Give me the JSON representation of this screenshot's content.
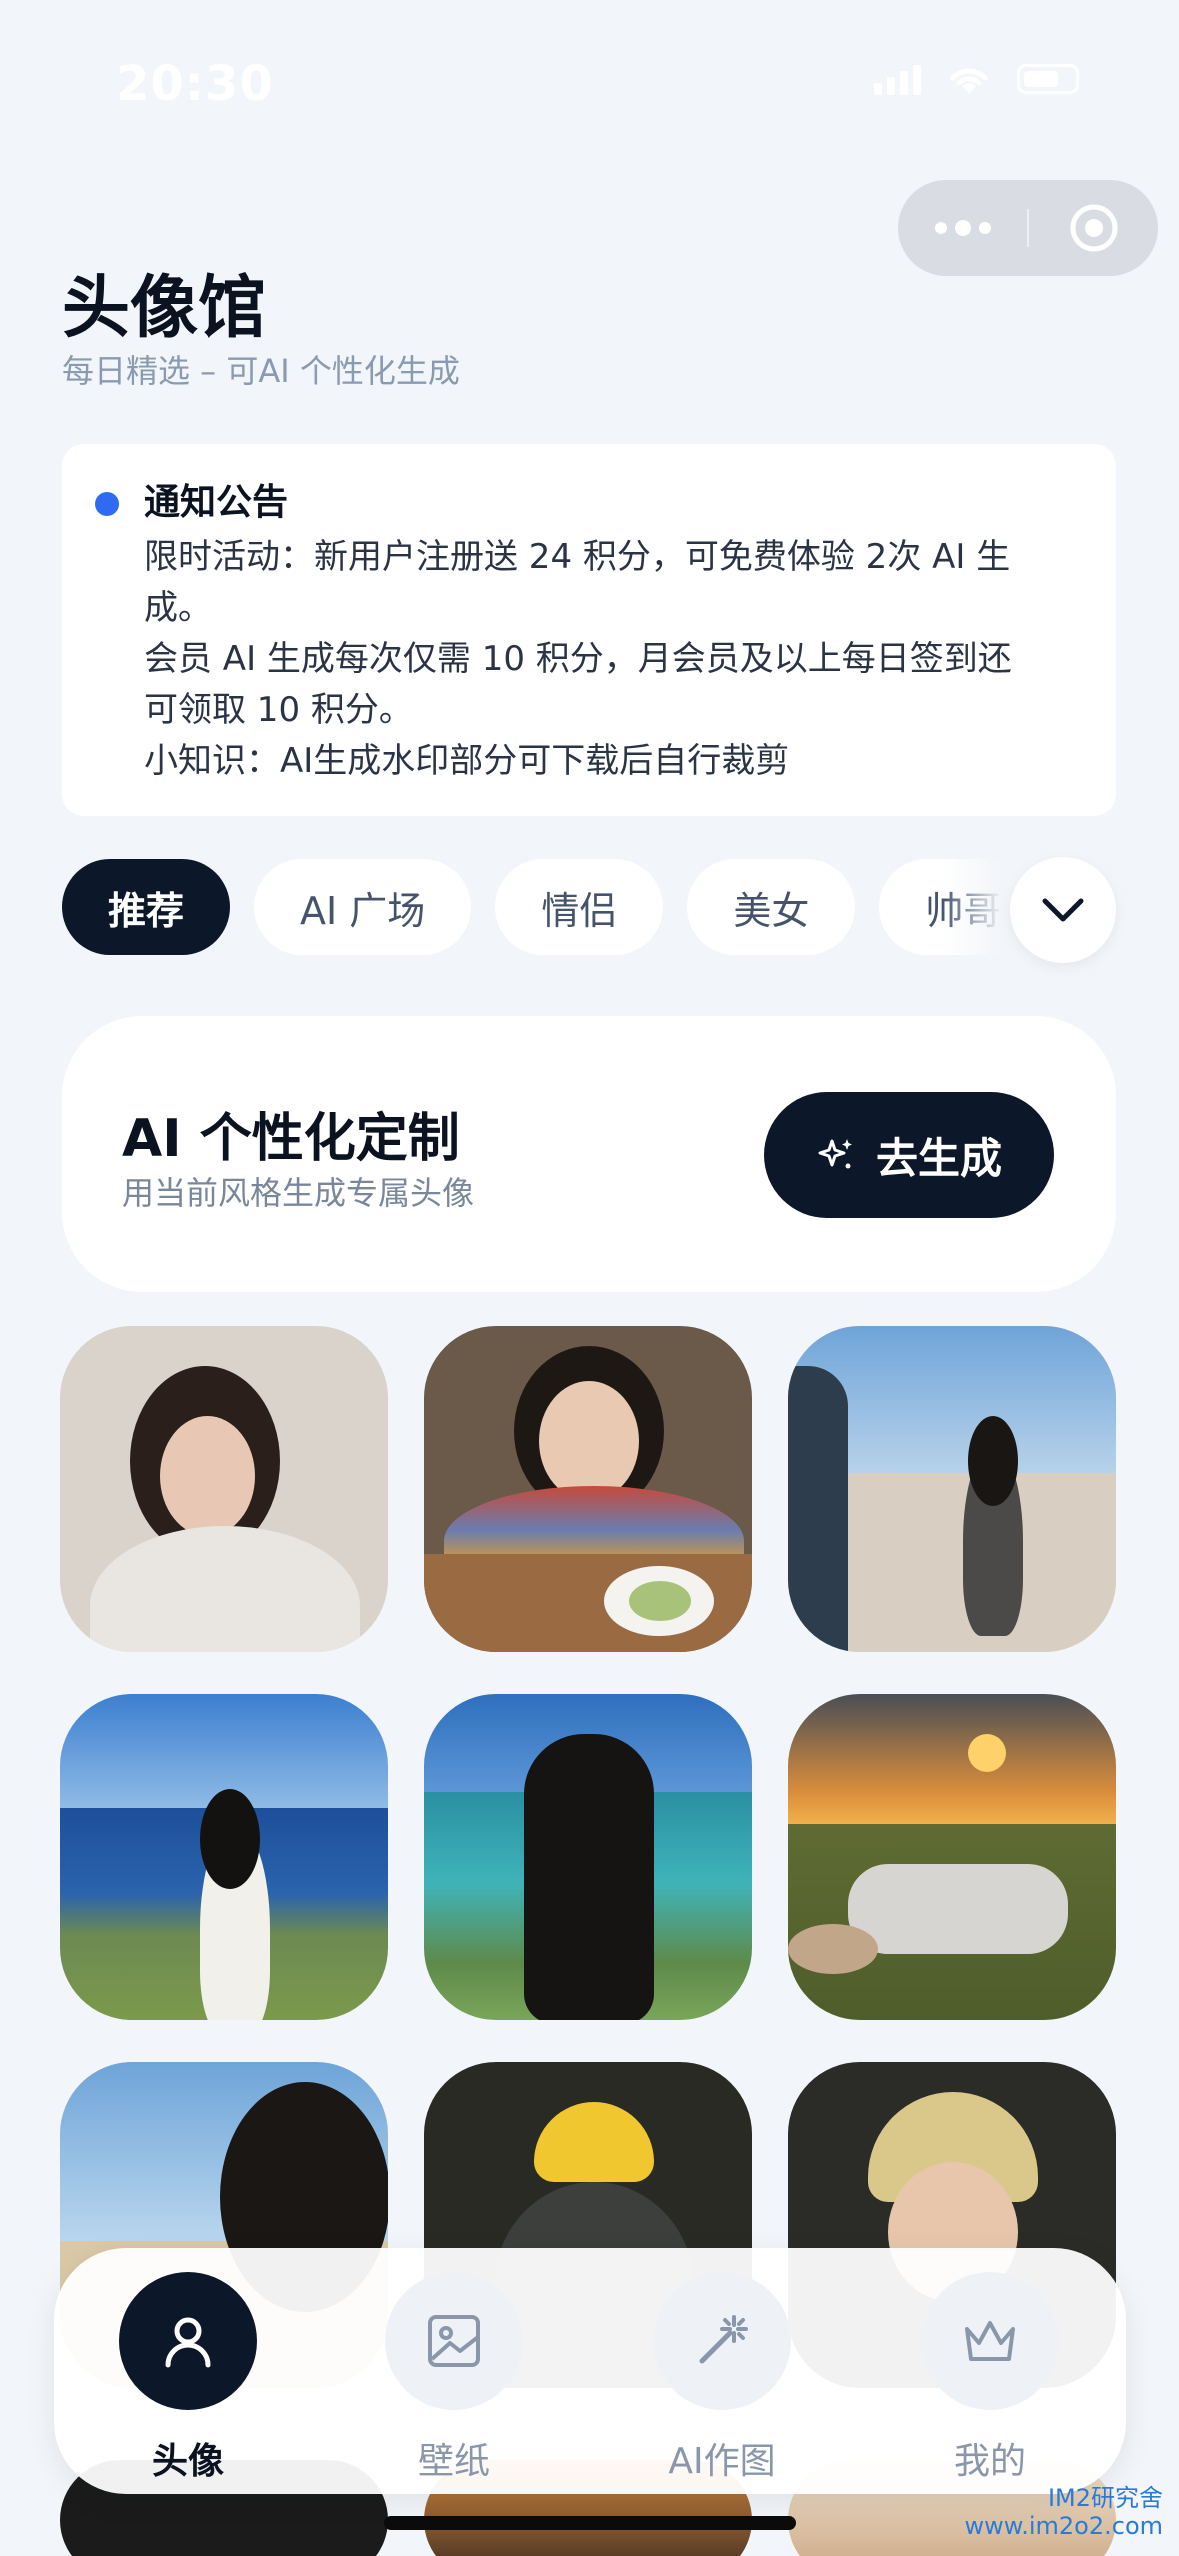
{
  "status_bar": {
    "time": "20:30"
  },
  "header": {
    "title": "头像馆",
    "subtitle": "每日精选 – 可AI 个性化生成"
  },
  "notice": {
    "title": "通知公告",
    "lines": [
      "限时活动：新用户注册送 24 积分，可免费体验 2次 AI 生",
      "成。",
      "会员 AI 生成每次仅需 10 积分，月会员及以上每日签到还",
      "可领取 10 积分。",
      "小知识：AI生成水印部分可下载后自行裁剪"
    ],
    "dot_color": "#2f6bf2"
  },
  "tabs": {
    "items": [
      "推荐",
      "AI 广场",
      "情侣",
      "美女",
      "帅哥"
    ],
    "active": "推荐"
  },
  "ai_card": {
    "title": "AI 个性化定制",
    "subtitle": "用当前风格生成专属头像",
    "button_label": "去生成"
  },
  "gallery": {
    "items": [
      {
        "name": "girl-hand-on-head"
      },
      {
        "name": "girl-smiling-cafe"
      },
      {
        "name": "girl-desert-road"
      },
      {
        "name": "girl-seaside-cliff"
      },
      {
        "name": "girl-ocean-view"
      },
      {
        "name": "girl-lying-grass-sunset"
      },
      {
        "name": "girl-beach-profile"
      },
      {
        "name": "girl-yellow-helmet"
      },
      {
        "name": "person-helmet-glasses"
      }
    ]
  },
  "bottom_nav": {
    "items": [
      {
        "label": "头像",
        "icon": "user-icon",
        "active": true
      },
      {
        "label": "壁纸",
        "icon": "image-icon",
        "active": false
      },
      {
        "label": "AI作图",
        "icon": "magic-wand-icon",
        "active": false
      },
      {
        "label": "我的",
        "icon": "crown-icon",
        "active": false
      }
    ]
  },
  "watermark": {
    "line1": "IM2研究舍",
    "line2": "www.im2o2.com"
  },
  "colors": {
    "accent_dark": "#0c1729",
    "background": "#f2f5f9"
  }
}
